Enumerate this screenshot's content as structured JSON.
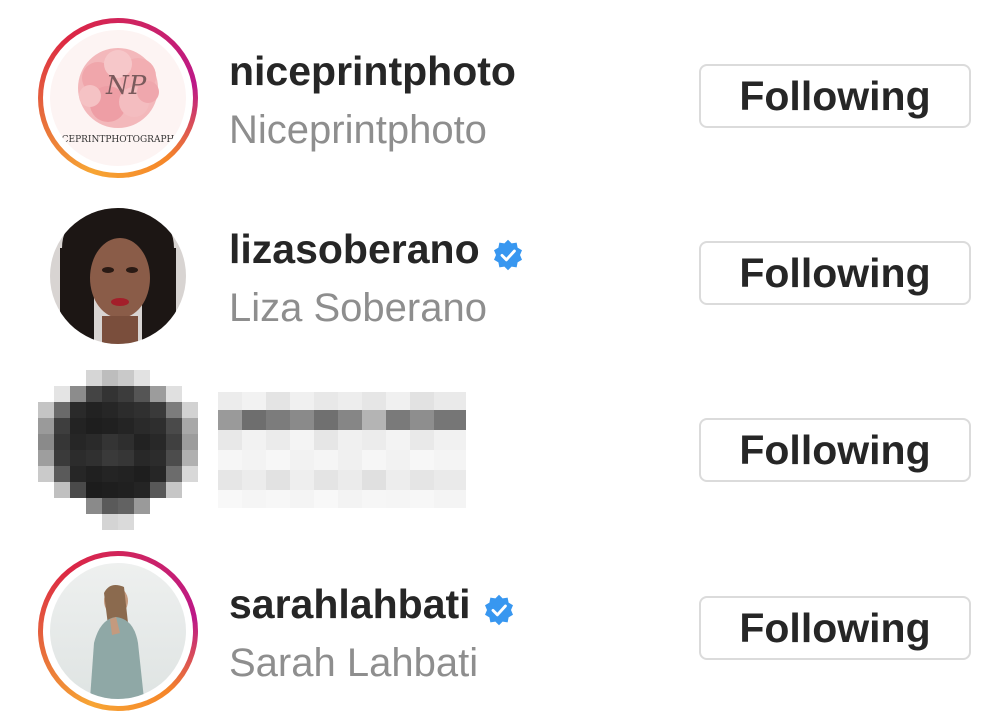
{
  "rows": [
    {
      "username": "niceprintphoto",
      "full_name": "Niceprintphoto",
      "verified": false,
      "button_label": "Following",
      "avatar_text": "CEPRINTPHOTOGRAPH",
      "avatar_monogram": "NP"
    },
    {
      "username": "lizasoberano",
      "full_name": "Liza Soberano",
      "verified": true,
      "button_label": "Following"
    },
    {
      "username": "",
      "full_name": "",
      "verified": false,
      "redacted": true,
      "button_label": "Following"
    },
    {
      "username": "sarahlahbati",
      "full_name": "Sarah Lahbati",
      "verified": true,
      "button_label": "Following"
    }
  ],
  "colors": {
    "username": "#262626",
    "full_name": "#8e8e8e",
    "verified_badge": "#3897f0",
    "button_border": "#dbdbdb"
  },
  "icons": {
    "verified": "verified-badge-icon"
  }
}
